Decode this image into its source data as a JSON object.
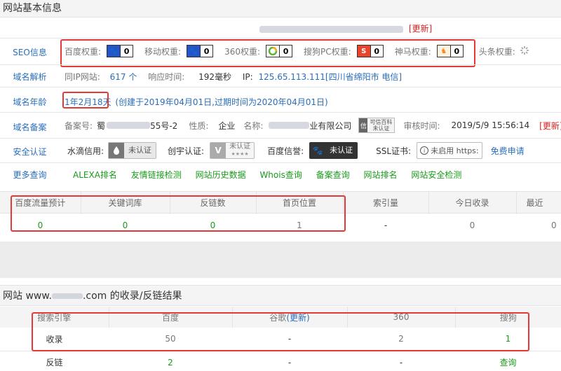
{
  "section1": {
    "title": "网站基本信息"
  },
  "top_row": {
    "update": "[更新]"
  },
  "seo": {
    "label": "SEO信息",
    "items": [
      {
        "label": "百度权重:",
        "value": "0",
        "icon": "baidu-paw-icon",
        "color": "#2255cc"
      },
      {
        "label": "移动权重:",
        "value": "0",
        "icon": "baidu-paw-icon",
        "color": "#2255cc"
      },
      {
        "label": "360权重:",
        "value": "0",
        "icon": "360-ring-icon",
        "color": "#5cb531"
      },
      {
        "label": "搜狗PC权重:",
        "value": "0",
        "icon": "sogou-s-icon",
        "color": "#e8452c"
      },
      {
        "label": "神马权重:",
        "value": "0",
        "icon": "shenma-horse-icon",
        "color": "#f08a1c"
      }
    ],
    "toutiao_label": "头条权重:"
  },
  "domain_resolve": {
    "label": "域名解析",
    "same_ip_label": "同IP网站:",
    "same_ip_value": "617 个",
    "response_label": "响应时间:",
    "response_value": "192毫秒",
    "ip_label": "IP:",
    "ip_value": "125.65.113.111[四川省绵阳市 电信]"
  },
  "domain_age": {
    "label": "域名年龄",
    "age": "1年2月18天",
    "detail": "(创建于2019年04月01日,过期时间为2020年04月01日)"
  },
  "beian": {
    "label": "域名备案",
    "number_label": "备案号:",
    "number_prefix": "蜀",
    "number_suffix": "55号-2",
    "nature_label": "性质:",
    "nature_value": "企业",
    "name_label": "名称:",
    "name_suffix": "业有限公司",
    "kexin_line1": "可信百科",
    "kexin_line2": "未认证",
    "review_label": "审核时间:",
    "review_value": "2019/5/9 15:56:14",
    "update": "[更新]"
  },
  "security": {
    "label": "安全认证",
    "shuidi_label": "水滴信用:",
    "shuidi_btn": "未认证",
    "chuangyu_label": "创宇认证:",
    "chuangyu_btn": "未认证",
    "chuangyu_stars": "★★★★",
    "baidu_label": "百度信誉:",
    "baidu_btn": "未认证",
    "ssl_label": "SSL证书:",
    "ssl_btn": "未启用 https:",
    "free_apply": "免费申请"
  },
  "more": {
    "label": "更多查询",
    "links": [
      "ALEXA排名",
      "友情链接检测",
      "网站历史数据",
      "Whois查询",
      "备案查询",
      "网站排名",
      "网站安全检测"
    ]
  },
  "stats": {
    "headers": [
      "百度流量预计",
      "关键词库",
      "反链数",
      "首页位置",
      "索引量",
      "今日收录",
      "最近"
    ],
    "values": [
      "0",
      "0",
      "0",
      "1",
      "-",
      "0",
      "0"
    ]
  },
  "section2": {
    "title_prefix": "网站 www.",
    "title_suffix": ".com 的收录/反链结果"
  },
  "index_table": {
    "headers": [
      "搜索引擎",
      "百度",
      "谷歌",
      "(更新)",
      "360",
      "搜狗"
    ],
    "rows": [
      {
        "label": "收录",
        "values": [
          "50",
          "-",
          "2",
          "1"
        ]
      },
      {
        "label": "反链",
        "values": [
          "2",
          "-",
          "-",
          "查询"
        ]
      }
    ]
  }
}
